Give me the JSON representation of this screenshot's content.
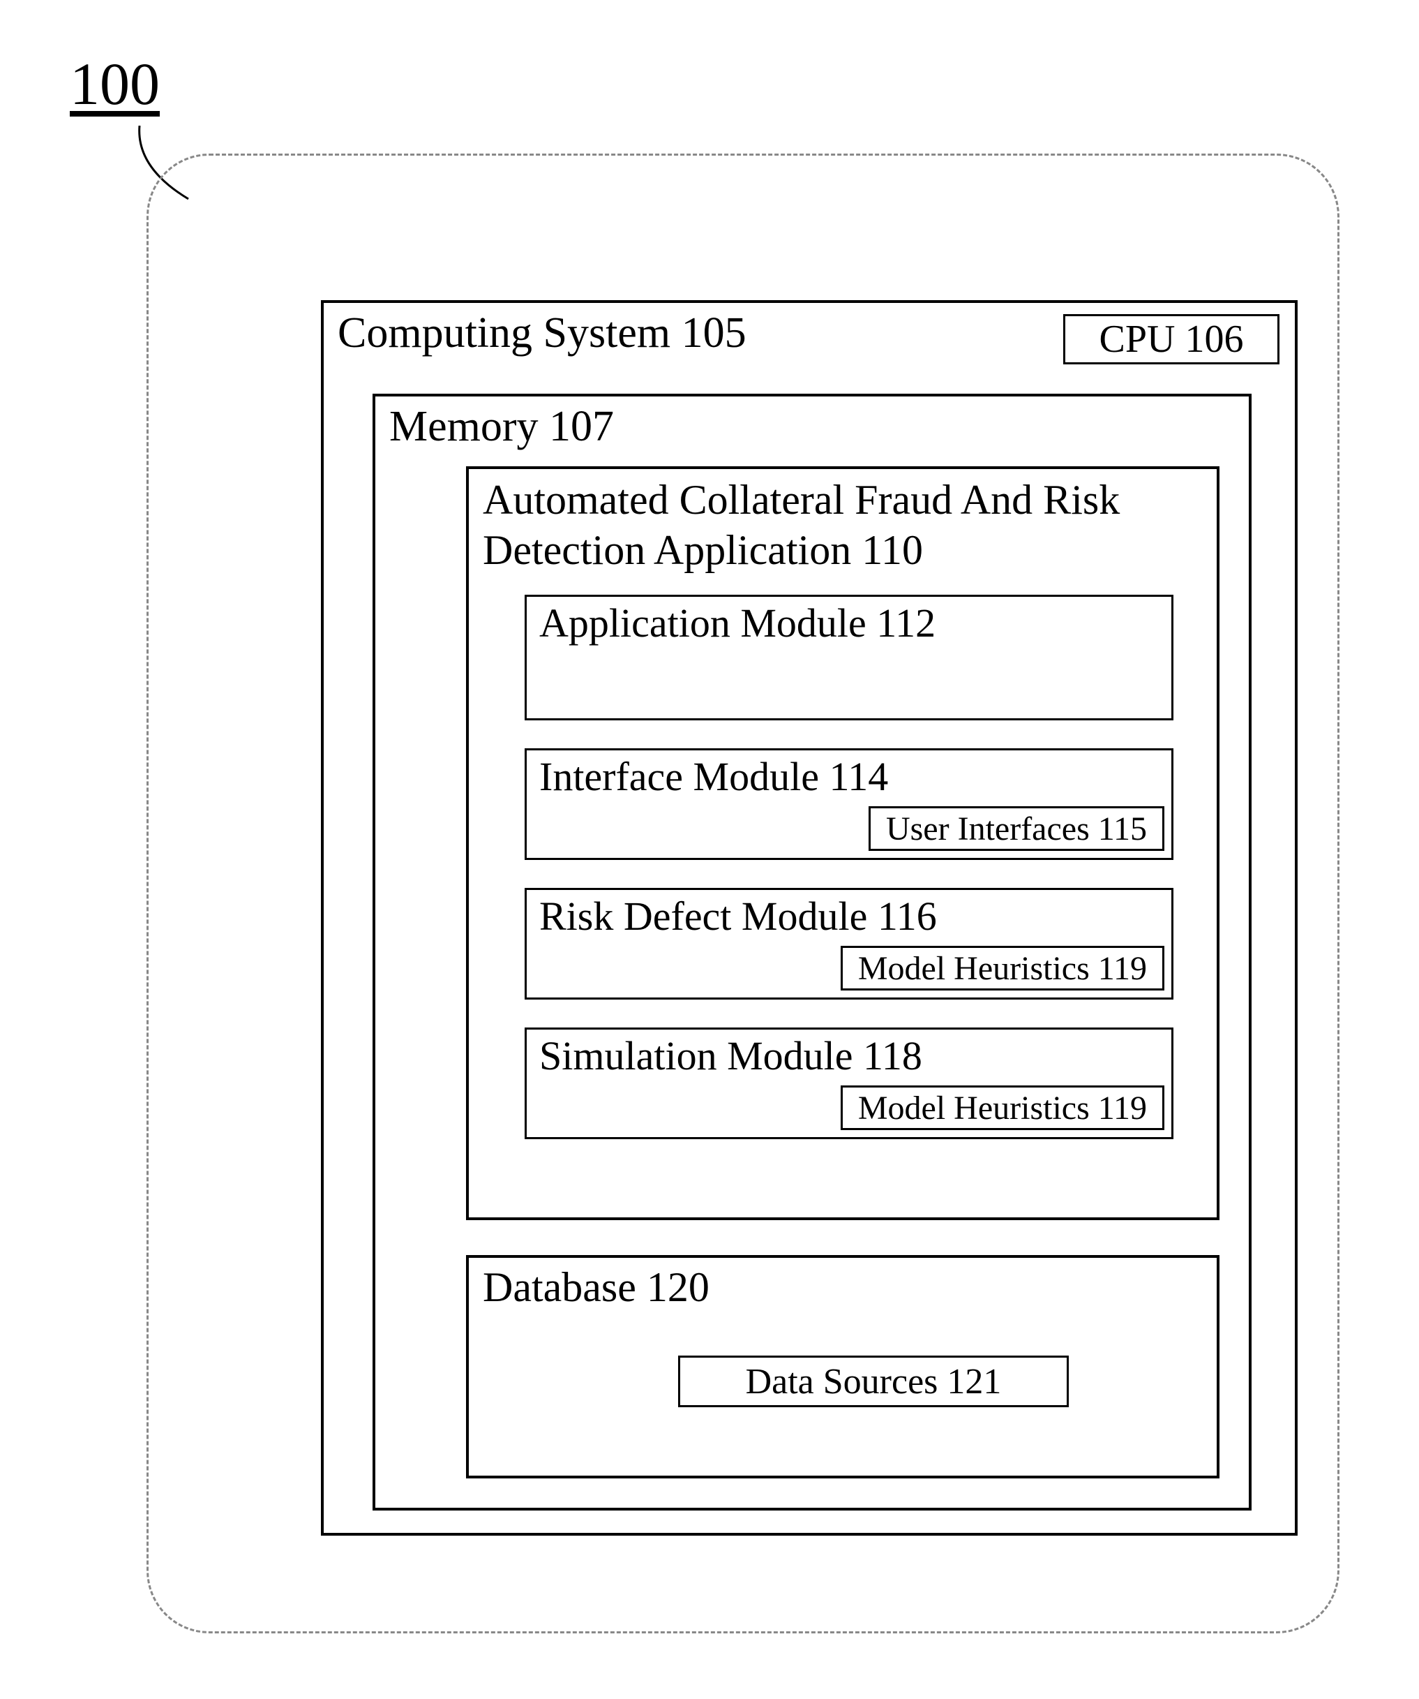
{
  "figure_number": "100",
  "outer": {
    "label": ""
  },
  "computing_system": {
    "title": "Computing System 105",
    "cpu": "CPU 106",
    "memory": {
      "title": "Memory 107",
      "application": {
        "title": "Automated Collateral Fraud And Risk Detection Application 110",
        "modules": [
          {
            "title": "Application Module 112",
            "sub": null
          },
          {
            "title": "Interface Module 114",
            "sub": "User Interfaces 115"
          },
          {
            "title": "Risk Defect Module 116",
            "sub": "Model Heuristics 119"
          },
          {
            "title": "Simulation Module 118",
            "sub": "Model Heuristics 119"
          }
        ]
      },
      "database": {
        "title": "Database 120",
        "data_sources": "Data Sources 121"
      }
    }
  }
}
